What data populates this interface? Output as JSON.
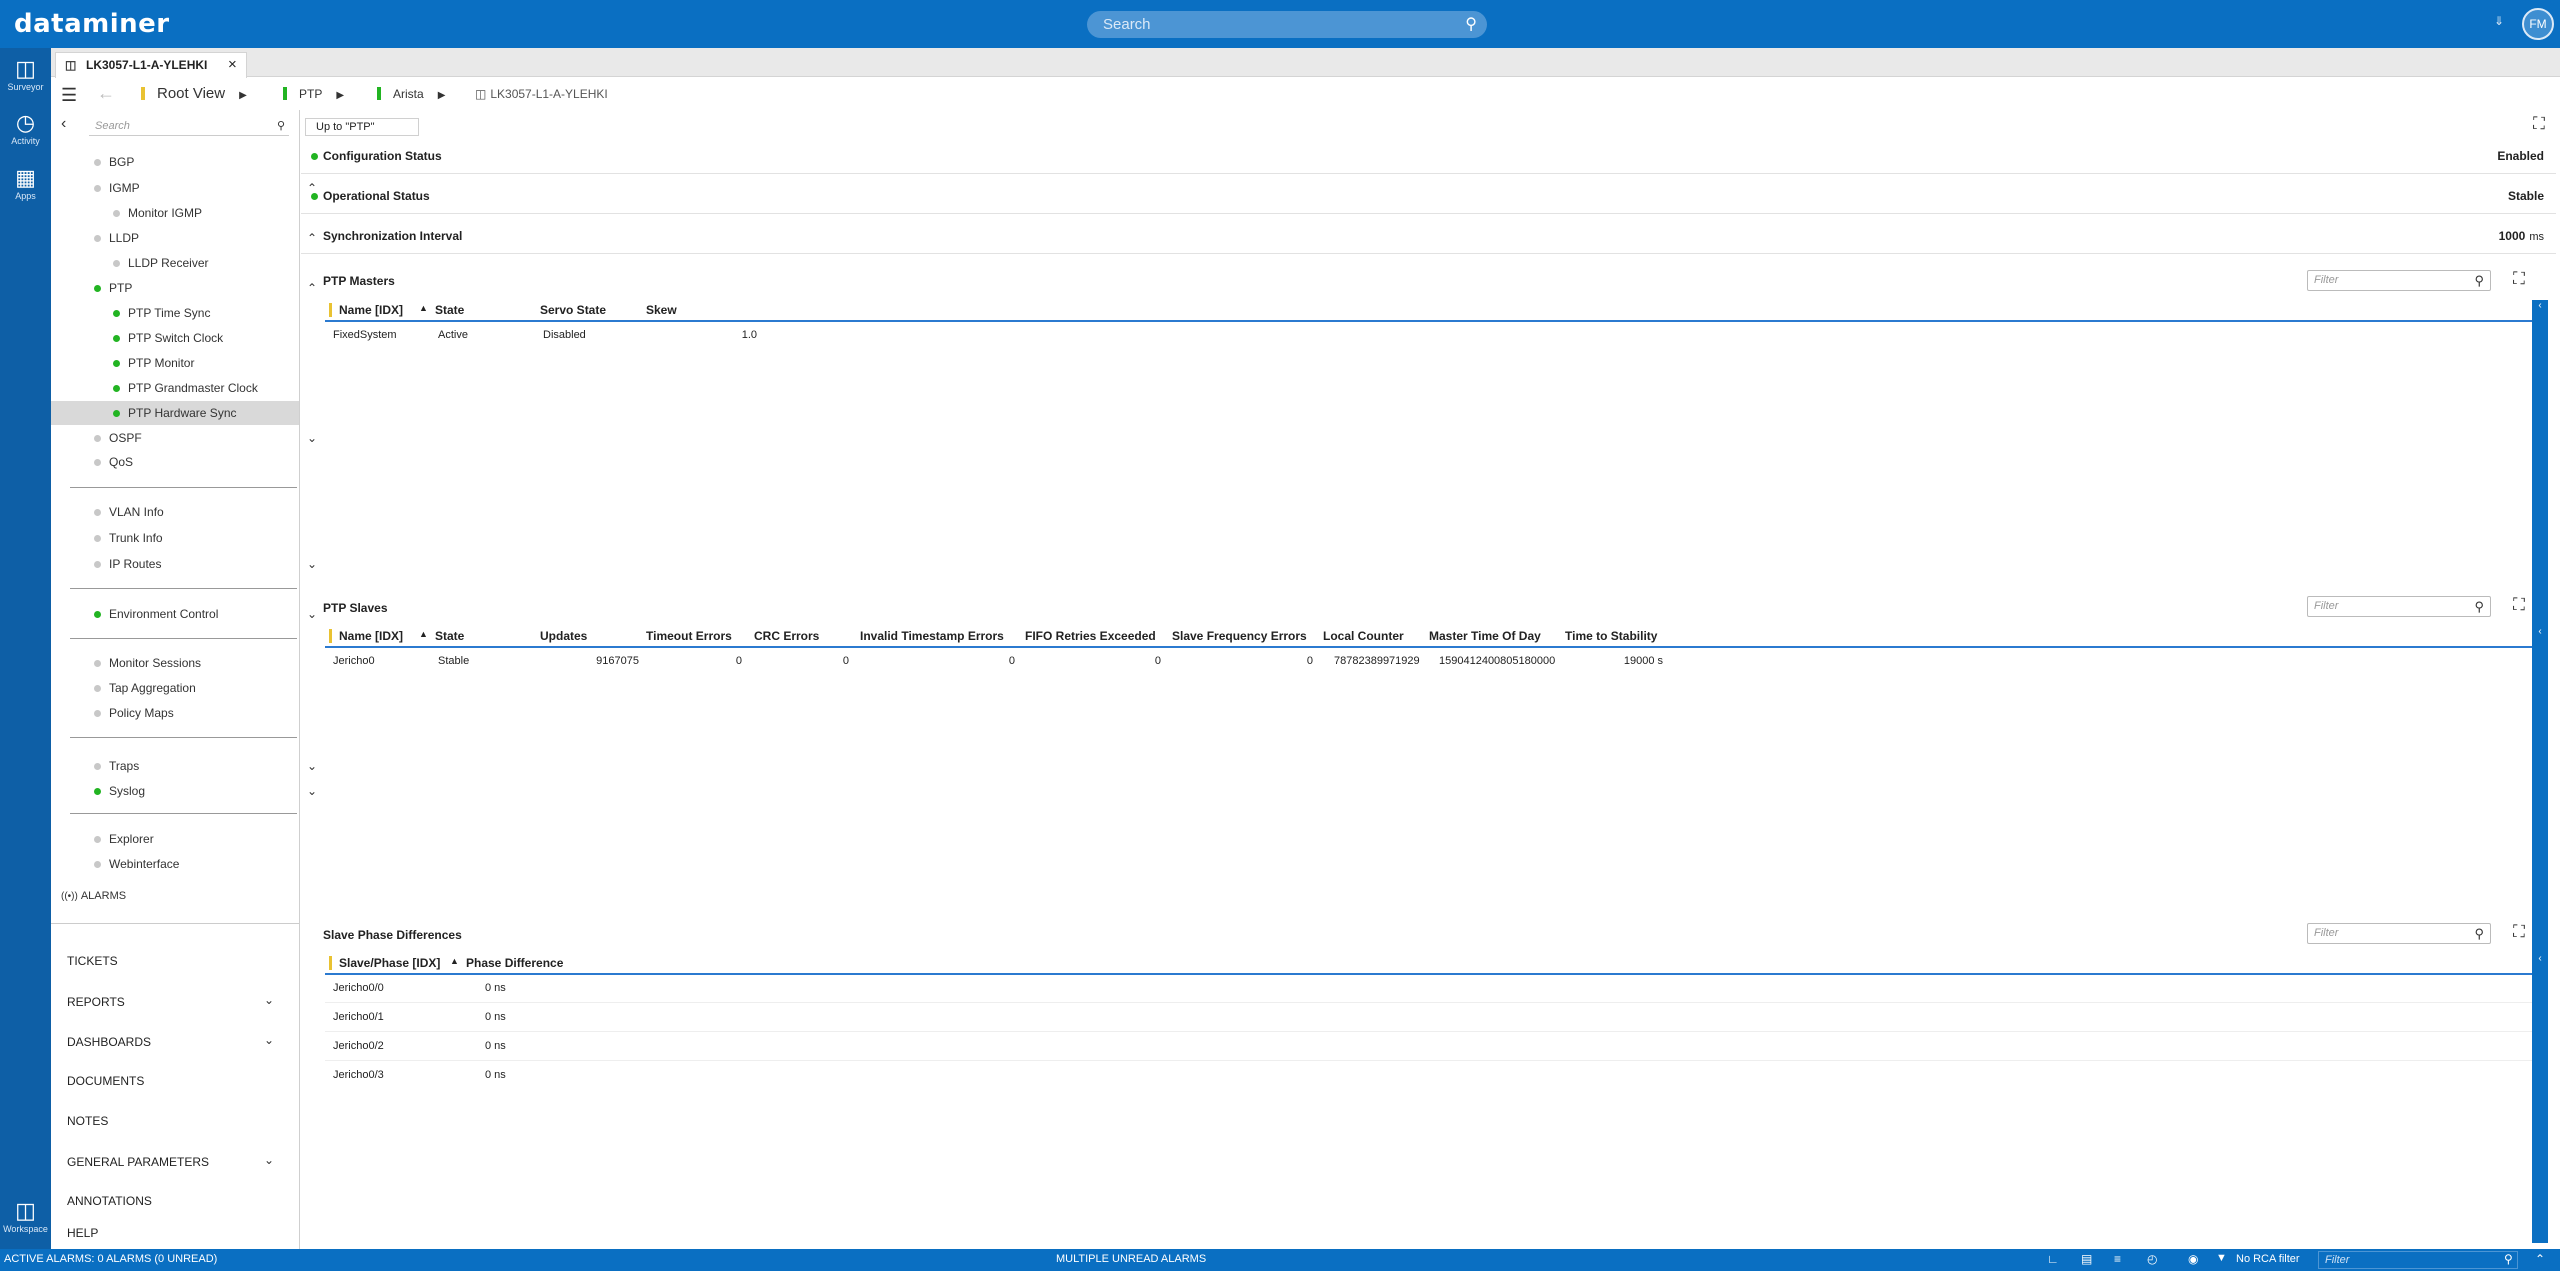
{
  "app": {
    "logo": "dataminer",
    "search_placeholder": "Search",
    "avatar": "FM"
  },
  "rail": {
    "items": [
      {
        "label": "Surveyor",
        "icon": "surveyor-icon"
      },
      {
        "label": "Activity",
        "icon": "activity-icon"
      },
      {
        "label": "Apps",
        "icon": "apps-icon"
      },
      {
        "label": "Workspace",
        "icon": "workspace-icon"
      }
    ]
  },
  "tab": {
    "title": "LK3057-L1-A-YLEHKI"
  },
  "breadcrumb": {
    "root": "Root View",
    "items": [
      "PTP",
      "Arista",
      "LK3057-L1-A-YLEHKI"
    ]
  },
  "sidebar": {
    "search_placeholder": "Search",
    "tree": [
      {
        "label": "BGP"
      },
      {
        "label": "IGMP"
      },
      {
        "label": "Monitor IGMP"
      },
      {
        "label": "LLDP"
      },
      {
        "label": "LLDP Receiver"
      },
      {
        "label": "PTP"
      },
      {
        "label": "PTP Time Sync"
      },
      {
        "label": "PTP Switch Clock"
      },
      {
        "label": "PTP Monitor"
      },
      {
        "label": "PTP Grandmaster Clock"
      },
      {
        "label": "PTP Hardware Sync"
      },
      {
        "label": "OSPF"
      },
      {
        "label": "QoS"
      },
      {
        "label": "VLAN Info"
      },
      {
        "label": "Trunk Info"
      },
      {
        "label": "IP Routes"
      },
      {
        "label": "Environment Control"
      },
      {
        "label": "Monitor Sessions"
      },
      {
        "label": "Tap Aggregation"
      },
      {
        "label": "Policy Maps"
      },
      {
        "label": "Traps"
      },
      {
        "label": "Syslog"
      },
      {
        "label": "Explorer"
      },
      {
        "label": "Webinterface"
      }
    ],
    "alarms": "ALARMS",
    "bottom": [
      "TICKETS",
      "REPORTS",
      "DASHBOARDS",
      "DOCUMENTS",
      "NOTES",
      "GENERAL PARAMETERS",
      "ANNOTATIONS",
      "HELP"
    ]
  },
  "main": {
    "up_to": "Up to \"PTP\"",
    "params": [
      {
        "label": "Configuration Status",
        "value": "Enabled",
        "unit": ""
      },
      {
        "label": "Operational Status",
        "value": "Stable",
        "unit": ""
      },
      {
        "label": "Synchronization Interval",
        "value": "1000",
        "unit": "ms"
      }
    ],
    "filter_placeholder": "Filter",
    "masters": {
      "title": "PTP Masters",
      "columns": [
        "Name [IDX]",
        "State",
        "Servo State",
        "Skew"
      ],
      "rows": [
        [
          "FixedSystem",
          "Active",
          "Disabled",
          "1.0"
        ]
      ]
    },
    "slaves": {
      "title": "PTP Slaves",
      "columns": [
        "Name [IDX]",
        "State",
        "Updates",
        "Timeout Errors",
        "CRC Errors",
        "Invalid Timestamp Errors",
        "FIFO Retries Exceeded",
        "Slave Frequency Errors",
        "Local Counter",
        "Master Time Of Day",
        "Time to Stability"
      ],
      "rows": [
        [
          "Jericho0",
          "Stable",
          "9167075",
          "0",
          "0",
          "0",
          "0",
          "0",
          "78782389971929",
          "1590412400805180000",
          "19000 s"
        ]
      ]
    },
    "phase": {
      "title": "Slave Phase Differences",
      "columns": [
        "Slave/Phase [IDX]",
        "Phase Difference"
      ],
      "rows": [
        [
          "Jericho0/0",
          "0 ns"
        ],
        [
          "Jericho0/1",
          "0 ns"
        ],
        [
          "Jericho0/2",
          "0 ns"
        ],
        [
          "Jericho0/3",
          "0 ns"
        ]
      ]
    }
  },
  "statusbar": {
    "alarms": "ACTIVE ALARMS: 0 ALARMS (0 UNREAD)",
    "unread": "MULTIPLE UNREAD ALARMS",
    "rca": "No RCA filter",
    "filter_placeholder": "Filter"
  },
  "colors": {
    "brand": "#0a6fc2",
    "ok": "#22b422",
    "neutral": "#c8c8c8",
    "header_line": "#2b7ad0"
  }
}
